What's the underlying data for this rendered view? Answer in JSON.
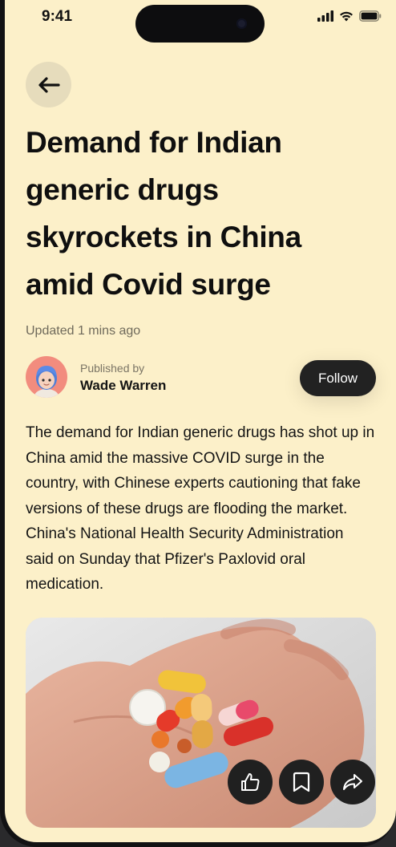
{
  "status_bar": {
    "time": "9:41",
    "icons": [
      "signal-icon",
      "wifi-icon",
      "battery-icon"
    ]
  },
  "nav": {
    "back_icon": "arrow-left-icon"
  },
  "article": {
    "title": "Demand for Indian generic drugs skyrockets in China amid Covid surge",
    "updated": "Updated 1 mins ago",
    "published_label": "Published by",
    "author": "Wade Warren",
    "follow_label": "Follow",
    "body": "The demand for Indian generic drugs has shot up in China amid the massive COVID surge in the country, with Chinese experts cautioning that fake versions of these drugs are flooding the market. China's National Health Security Administration said on Sunday that Pfizer's Paxlovid oral medication."
  },
  "image": {
    "subject": "hand holding pills and capsules"
  },
  "actions": [
    {
      "icon": "thumbs-up-icon"
    },
    {
      "icon": "bookmark-icon"
    },
    {
      "icon": "share-icon"
    }
  ],
  "colors": {
    "background": "#fcf0c9",
    "back_button": "#e6dcbc",
    "dark_button": "#222222",
    "avatar_bg": "#f28c7e"
  }
}
